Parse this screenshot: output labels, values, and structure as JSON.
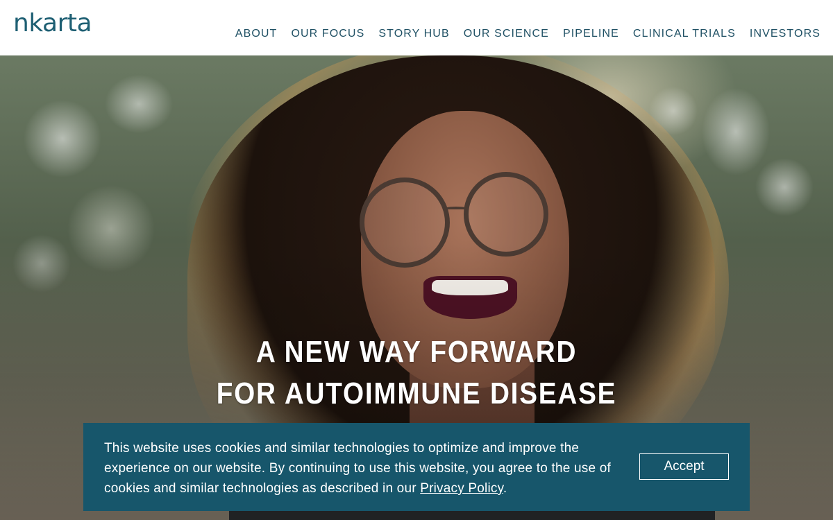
{
  "brand": {
    "logo_text": "nkarta",
    "logo_color": "#1e5f73"
  },
  "nav": {
    "items": [
      {
        "label": "ABOUT"
      },
      {
        "label": "OUR FOCUS"
      },
      {
        "label": "STORY HUB"
      },
      {
        "label": "OUR SCIENCE"
      },
      {
        "label": "PIPELINE"
      },
      {
        "label": "CLINICAL TRIALS"
      },
      {
        "label": "INVESTORS"
      }
    ],
    "color": "#1f5064"
  },
  "hero": {
    "headline_line1": "A NEW WAY FORWARD",
    "headline_line2": "FOR AUTOIMMUNE DISEASE"
  },
  "cookie_banner": {
    "text_before_link": "This website uses cookies and similar technologies to optimize and improve the experience on our website. By continuing to use this website, you agree to the use of cookies and similar technologies as described in our ",
    "link_text": "Privacy Policy",
    "text_after_link": ".",
    "accept_label": "Accept",
    "background_color": "#17566b"
  }
}
